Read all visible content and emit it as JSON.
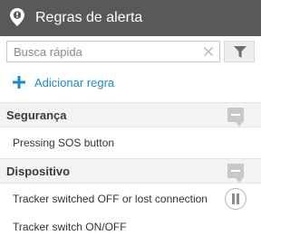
{
  "header": {
    "title": "Regras de alerta",
    "icon": "map-pin-icon"
  },
  "search": {
    "placeholder": "Busca rápida",
    "value": ""
  },
  "toolbar": {
    "filter_icon": "filter-icon",
    "add_rule_label": "Adicionar regra"
  },
  "groups": [
    {
      "title": "Segurança",
      "rules": [
        {
          "label": "Pressing SOS button"
        }
      ]
    },
    {
      "title": "Dispositivo",
      "rules": [
        {
          "label": "Tracker switched OFF or lost connection"
        },
        {
          "label": "Tracker switch ON/OFF"
        }
      ]
    }
  ],
  "colors": {
    "header_bg": "#59595b",
    "accent": "#1a8bc9",
    "group_bg": "#f3f3f3"
  }
}
